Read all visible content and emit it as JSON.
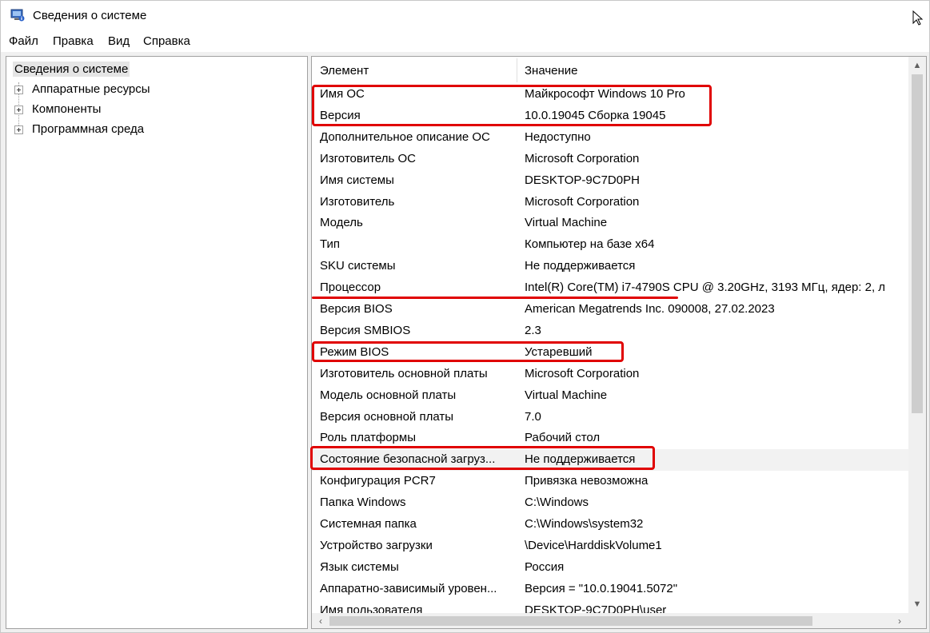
{
  "window": {
    "title": "Сведения о системе"
  },
  "menu": {
    "items": [
      "Файл",
      "Правка",
      "Вид",
      "Справка"
    ]
  },
  "tree": {
    "root": "Сведения о системе",
    "children": [
      "Аппаратные ресурсы",
      "Компоненты",
      "Программная среда"
    ]
  },
  "list": {
    "columns": {
      "name": "Элемент",
      "value": "Значение"
    },
    "rows": [
      {
        "name": "Имя ОС",
        "value": "Майкрософт Windows 10 Pro"
      },
      {
        "name": "Версия",
        "value": "10.0.19045 Сборка 19045"
      },
      {
        "name": "Дополнительное описание ОС",
        "value": "Недоступно"
      },
      {
        "name": "Изготовитель ОС",
        "value": "Microsoft Corporation"
      },
      {
        "name": "Имя системы",
        "value": "DESKTOP-9C7D0PH"
      },
      {
        "name": "Изготовитель",
        "value": "Microsoft Corporation"
      },
      {
        "name": "Модель",
        "value": "Virtual Machine"
      },
      {
        "name": "Тип",
        "value": "Компьютер на базе x64"
      },
      {
        "name": "SKU системы",
        "value": "Не поддерживается"
      },
      {
        "name": "Процессор",
        "value": "Intel(R) Core(TM) i7-4790S CPU @ 3.20GHz, 3193 МГц, ядер: 2, л"
      },
      {
        "name": "Версия BIOS",
        "value": "American Megatrends Inc. 090008, 27.02.2023"
      },
      {
        "name": "Версия SMBIOS",
        "value": "2.3"
      },
      {
        "name": "Режим BIOS",
        "value": "Устаревший"
      },
      {
        "name": "Изготовитель основной платы",
        "value": "Microsoft Corporation"
      },
      {
        "name": "Модель основной платы",
        "value": "Virtual Machine"
      },
      {
        "name": "Версия основной платы",
        "value": "7.0"
      },
      {
        "name": "Роль платформы",
        "value": "Рабочий стол"
      },
      {
        "name": "Состояние безопасной загруз...",
        "value": "Не поддерживается",
        "selected": true
      },
      {
        "name": "Конфигурация PCR7",
        "value": "Привязка невозможна"
      },
      {
        "name": "Папка Windows",
        "value": "C:\\Windows"
      },
      {
        "name": "Системная папка",
        "value": "C:\\Windows\\system32"
      },
      {
        "name": "Устройство загрузки",
        "value": "\\Device\\HarddiskVolume1"
      },
      {
        "name": "Язык системы",
        "value": "Россия"
      },
      {
        "name": "Аппаратно-зависимый уровен...",
        "value": "Версия = \"10.0.19041.5072\""
      },
      {
        "name": "Имя пользователя",
        "value": "DESKTOP-9C7D0PH\\user"
      }
    ]
  },
  "icons": {
    "app": "system-info-icon",
    "cursor": "mouse-pointer-icon",
    "scroll_up": "chevron-up-icon",
    "scroll_down": "chevron-down-icon",
    "scroll_left": "chevron-left-icon",
    "scroll_right": "chevron-right-icon",
    "expander": "plus-expander-icon"
  },
  "colors": {
    "annotation": "#e00000",
    "selected_row": "#f2f2f2",
    "tree_selected": "#e5e5e5"
  }
}
